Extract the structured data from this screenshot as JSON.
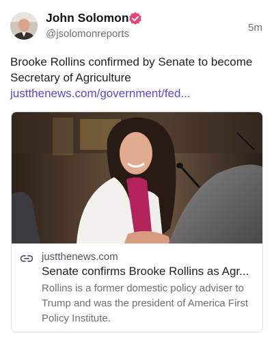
{
  "post": {
    "author_name": "John Solomon",
    "handle": "@jsolomonreports",
    "timestamp": "5m",
    "verified_color": "#e5457a",
    "text": "Brooke Rollins confirmed by Senate to become Secretary of Agriculture",
    "link_text": "justthenews.com/government/fed...",
    "link_color": "#5b48d9"
  },
  "card": {
    "domain": "justthenews.com",
    "title": "Senate confirms Brooke Rollins as Agr...",
    "description": "Rollins is a former domestic policy adviser to Trump and was the president of America First Policy Institute."
  },
  "icons": {
    "verified": "verified-badge-icon",
    "link": "link-icon"
  }
}
